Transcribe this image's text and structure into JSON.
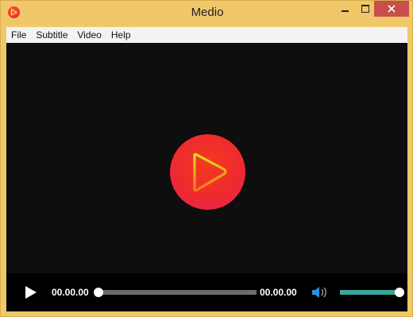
{
  "window": {
    "title": "Medio",
    "app_icon": "play-logo-icon",
    "buttons": [
      "minimize-icon",
      "maximize-icon",
      "close-icon"
    ]
  },
  "menu": {
    "items": [
      "File",
      "Subtitle",
      "Video",
      "Help"
    ]
  },
  "player": {
    "center_icon": "big-play-icon",
    "current_time": "00.00.00",
    "total_time": "00.00.00",
    "seek_fraction": 0,
    "volume_fraction": 1
  },
  "colors": {
    "window_frame": "#f0c869",
    "close_button": "#c7504a",
    "video_background": "#0e0e0e",
    "play_circle": "#ee2a2f",
    "volume_accent": "#3aa59b"
  }
}
